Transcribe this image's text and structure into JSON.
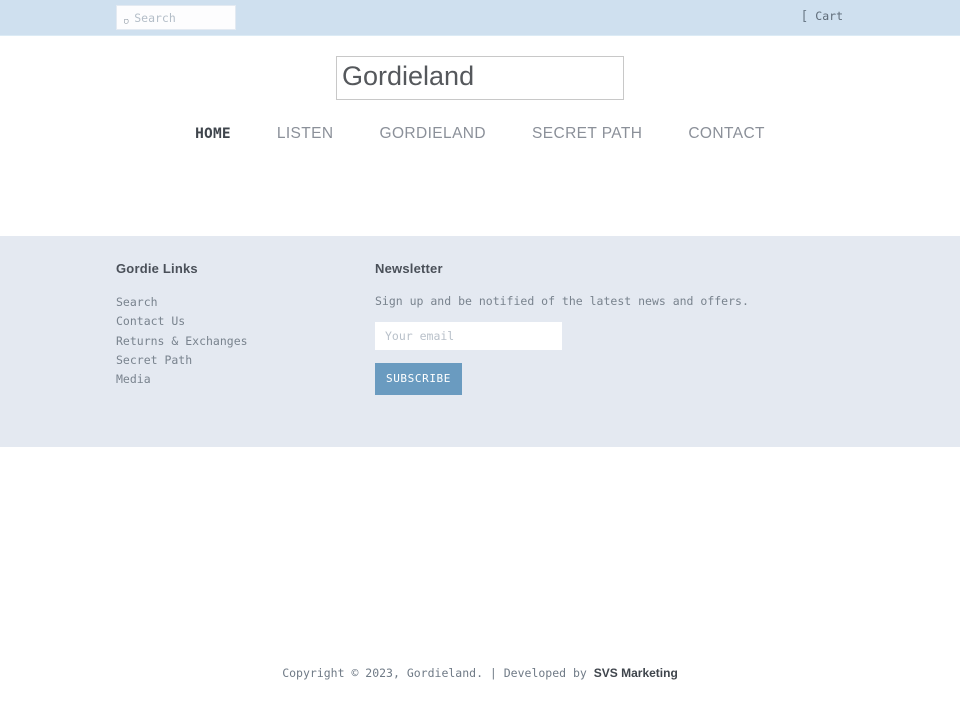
{
  "topbar": {
    "search": {
      "icon": "search-icon",
      "icon_glyph": "▢",
      "placeholder": "Search",
      "value": ""
    },
    "cart": {
      "icon": "cart-icon",
      "icon_glyph": "[",
      "label": "Cart"
    },
    "background_color": "#cfe0ef"
  },
  "header": {
    "logo_alt_text": "Gordieland"
  },
  "nav": {
    "items": [
      {
        "label": "HOME",
        "active": true
      },
      {
        "label": "LISTEN",
        "active": false
      },
      {
        "label": "GORDIELAND",
        "active": false
      },
      {
        "label": "SECRET PATH",
        "active": false
      },
      {
        "label": "CONTACT",
        "active": false
      }
    ]
  },
  "footer": {
    "background_color": "#e4e9f1",
    "links_column": {
      "heading": "Gordie Links",
      "items": [
        "Search",
        "Contact Us",
        "Returns & Exchanges",
        "Secret Path",
        "Media"
      ]
    },
    "newsletter": {
      "heading": "Newsletter",
      "description": "Sign up and be notified of the latest news and offers.",
      "email_placeholder": "Your email",
      "email_value": "",
      "subscribe_label": "SUBSCRIBE",
      "subscribe_color": "#6a9bc0"
    },
    "copyright": {
      "text": "Copyright © 2023, Gordieland. | Developed by ",
      "developer": "SVS Marketing"
    }
  }
}
